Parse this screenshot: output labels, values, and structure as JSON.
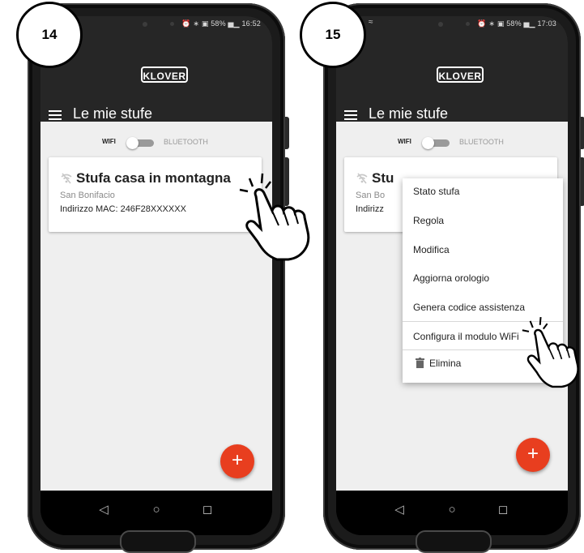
{
  "steps": [
    {
      "number": "14",
      "status_bar": "⏰ ∗ ▣ 58% ▅▁ 16:52",
      "logo": "KLOVER",
      "title": "Le mie stufe",
      "toggle": {
        "left_label": "WIFI",
        "right_label": "BLUETOOTH"
      },
      "card": {
        "title": "Stufa casa in montagna",
        "location": "San Bonifacio",
        "mac": "Indirizzo MAC: 246F28XXXXXX"
      },
      "fab_label": "+"
    },
    {
      "number": "15",
      "status_bar": "⏰ ∗ ▣ 58% ▅▁ 17:03",
      "logo": "KLOVER",
      "title": "Le mie stufe",
      "toggle": {
        "left_label": "WIFI",
        "right_label": "BLUETOOTH"
      },
      "card": {
        "title_partial": "Stu",
        "location_partial": "San Bo",
        "mac_partial": "Indirizz"
      },
      "menu": {
        "items": [
          "Stato stufa",
          "Regola",
          "Modifica",
          "Aggiorna orologio",
          "Genera codice assistenza",
          "Configura il modulo WiFi",
          "Elimina"
        ]
      },
      "fab_label": "+"
    }
  ],
  "nav_icons": [
    "back-triangle-icon",
    "home-circle-icon",
    "recents-square-icon"
  ],
  "colors": {
    "appbar": "#262626",
    "content": "#efefef",
    "fab": "#e83e1f",
    "phone": "#1b1b1b"
  }
}
